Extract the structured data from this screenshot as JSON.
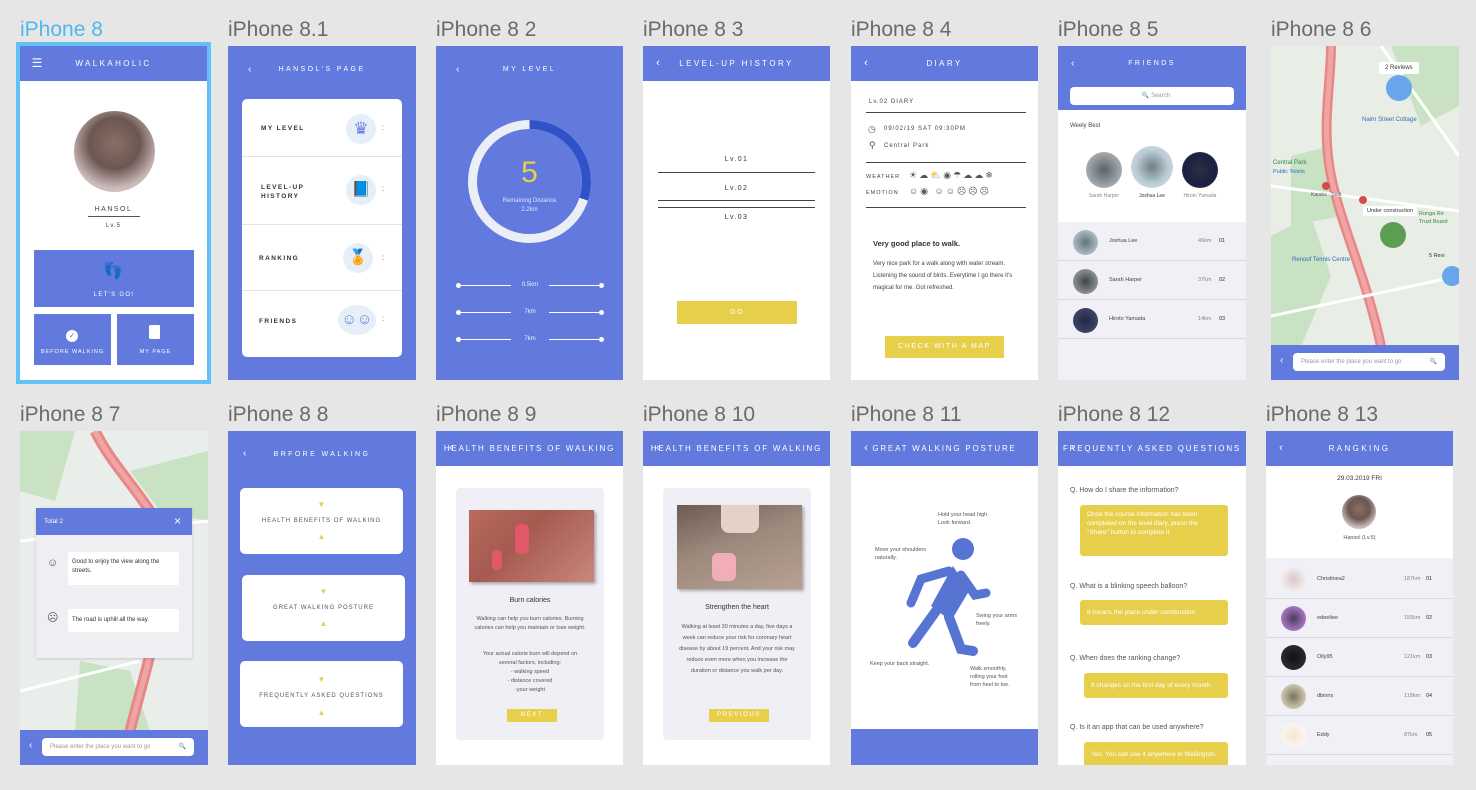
{
  "frames": {
    "f1": "iPhone 8",
    "f2": "iPhone 8.1",
    "f3": "iPhone 8 2",
    "f4": "iPhone 8 3",
    "f5": "iPhone 8 4",
    "f6": "iPhone 8 5",
    "f7": "iPhone 8 6",
    "f8": "iPhone 8 7",
    "f9": "iPhone 8 8",
    "f10": "iPhone 8 9",
    "f11": "iPhone 8 10",
    "f12": "iPhone 8 11",
    "f13": "iPhone 8 12",
    "f14": "iPhone 8 13"
  },
  "colors": {
    "primary": "#6279dd",
    "accent": "#e8cf4b",
    "selection": "#62c2f5"
  },
  "home": {
    "title": "WALKAHOLIC",
    "name": "HANSOL",
    "level": "Lv.5",
    "lets_go": "LET'S GO!",
    "before_walking": "BEFORE WALKING",
    "my_page": "MY PAGE"
  },
  "mypage": {
    "title": "HANSOL'S PAGE",
    "items": [
      "MY LEVEL",
      "LEVEL-UP\nHISTORY",
      "RANKING",
      "FRIENDS"
    ],
    "more": ":"
  },
  "mylevel": {
    "title": "MY LEVEL",
    "level": "5",
    "remaining_label": "Remaining Distance",
    "remaining_value": "2.2km",
    "sliders": [
      "0.5km",
      "7km",
      "7km"
    ],
    "progress": 0.3
  },
  "history": {
    "title": "LEVEL-UP HISTORY",
    "levels": [
      "Lv.01",
      "Lv.02",
      "Lv.03"
    ],
    "go": "GO"
  },
  "diary": {
    "title": "DIARY",
    "sub": "Lv.02 DIARY",
    "datetime": "09/02/19 SAT 09:30PM",
    "place": "Central Park",
    "weather_label": "WEATHER",
    "emotion_label": "EMOTION",
    "headline": "Very good place to walk.",
    "body": "Very nice park for a walk along with water stream. Listening the sound of birds. Everytime I go there it's magical for me. Got refreshed.",
    "check": "CHECK WITH A MAP"
  },
  "friends": {
    "title": "FRIENDS",
    "search": "Search",
    "weekly": "Weely Best",
    "best": [
      "Sarah Harper",
      "Joshua Lee",
      "Hiroto Yamada"
    ],
    "list": [
      {
        "name": "Joshua Lee",
        "dist": "46km",
        "rank": "01"
      },
      {
        "name": "Sarah Harper",
        "dist": "37km",
        "rank": "02"
      },
      {
        "name": "Hiroto Yamada",
        "dist": "14km",
        "rank": "03"
      }
    ]
  },
  "map1": {
    "reviews": "2 Reviews",
    "street": "Nairn Street Cottage",
    "park": "Central Park",
    "toilets": "Public Toilets",
    "karaka": "Karaka - Seat",
    "construction": "Under construction",
    "trust": "Trust Board",
    "tennis": "Renouf Tennis Centre",
    "reviews2": "5 Revi",
    "hospital": "Ronga Re",
    "search": "Please enter the place you want to go"
  },
  "map2": {
    "total": "Total 2",
    "comments": [
      "Good to enjoy the view along the streets.",
      "The road is uphill all the way."
    ],
    "search": "Please enter the place you want to go"
  },
  "before": {
    "title": "BRFORE WALKING",
    "items": [
      "HEALTH BENEFITS OF WALKING",
      "GREAT WALKING POSTURE",
      "FREQUENTLY ASKED QUESTIONS"
    ]
  },
  "health1": {
    "title": "HEALTH BENEFITS OF WALKING",
    "heading": "Burn calories",
    "p1": "Walking can help you burn calories. Burning calories can help you maintain or lose weight.",
    "p2": "Your actual calorie burn will depend on several factors, including:",
    "bullets": [
      "- walking speed",
      "- distance covered",
      "-your weight"
    ],
    "next": "NEXT"
  },
  "health2": {
    "title": "HEALTH BENEFITS OF WALKING",
    "heading": "Strengthen the heart",
    "p1": "Walking at least 30 minutes a day, five days a week can reduce your risk for coronary heart disease by about 19 percent. And your risk may reduce even more when you increase the duration or distance you walk per day.",
    "prev": "PREVIOUS"
  },
  "posture": {
    "title": "GREAT WALKING POSTURE",
    "head": "Hold your head high.\nLook forward.",
    "shoulders": "Move your shoulders\nnaturally.",
    "arms": "Swing your arms\nfreely.",
    "back": "Keep your back straight.",
    "smooth": "Walk smoothly,\nrolling your foot\nfrom heel to toe."
  },
  "faq": {
    "title": "FREQUENTLY ASKED QUESTIONS",
    "qa": [
      {
        "q": "Q. How do I share the information?",
        "a": "Once the course information has been completed on the level diary, press the \"Share\" button to complete it."
      },
      {
        "q": "Q. What is a blinking speech balloon?",
        "a": "It means the place under construction."
      },
      {
        "q": "Q. When does the ranking change?",
        "a": "It changes on the first day of every month."
      },
      {
        "q": "Q. Is it an app that can be used anywhere?",
        "a": "Yes, You can use it anywhere in Wellington."
      }
    ]
  },
  "ranking": {
    "title": "RANGKING",
    "date": "29.03.2019 FRI",
    "me": "Hansol (Lv.5)",
    "list": [
      {
        "name": "Christinea2",
        "dist": "187km",
        "rank": "01"
      },
      {
        "name": "edeeltee",
        "dist": "155km",
        "rank": "02"
      },
      {
        "name": "Olly95",
        "dist": "121km",
        "rank": "03"
      },
      {
        "name": "dbinns",
        "dist": "118km",
        "rank": "04"
      },
      {
        "name": "Eddy",
        "dist": "87km",
        "rank": "05"
      }
    ]
  }
}
